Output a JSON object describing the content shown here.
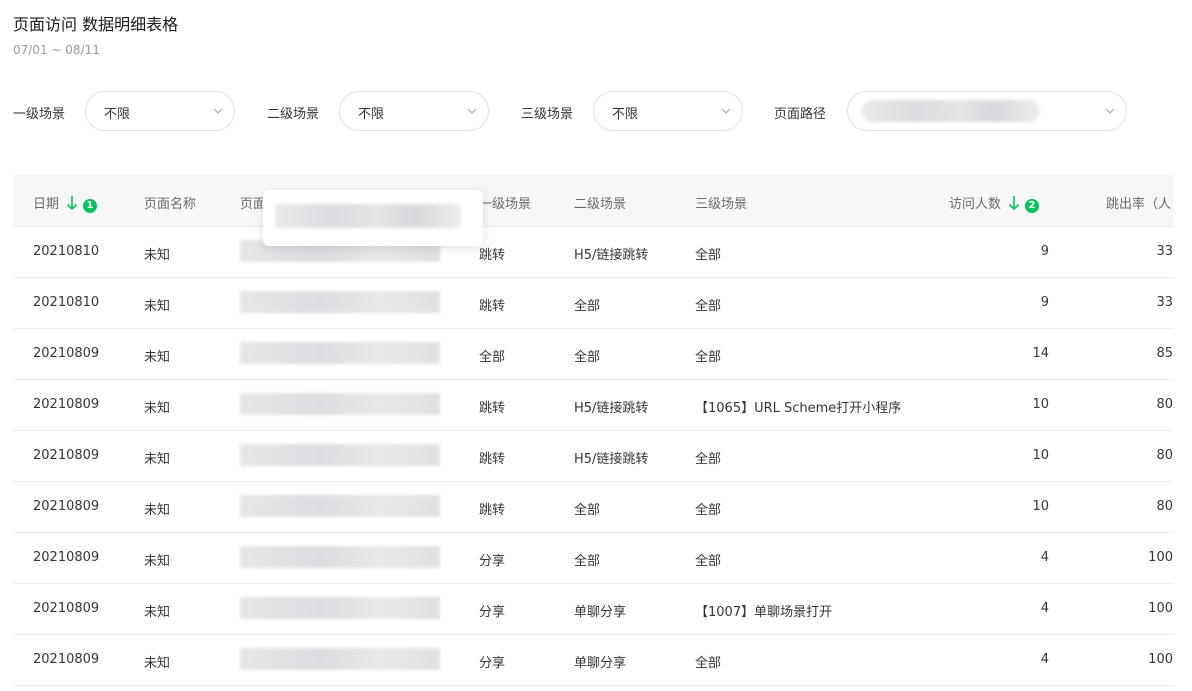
{
  "header": {
    "title": "页面访问 数据明细表格",
    "date_range": "07/01 ~ 08/11"
  },
  "filters": [
    {
      "label": "一级场景",
      "value": "不限"
    },
    {
      "label": "二级场景",
      "value": "不限"
    },
    {
      "label": "三级场景",
      "value": "不限"
    },
    {
      "label": "页面路径",
      "value": ""
    }
  ],
  "table": {
    "columns": [
      {
        "label": "日期",
        "sort": "desc",
        "badge": "1"
      },
      {
        "label": "页面名称"
      },
      {
        "label": "页面"
      },
      {
        "label": "一级场景"
      },
      {
        "label": "二级场景"
      },
      {
        "label": "三级场景"
      },
      {
        "label": "访问人数",
        "sort": "desc",
        "badge": "2"
      },
      {
        "label": "跳出率（人"
      }
    ],
    "rows": [
      {
        "date": "20210810",
        "name": "未知",
        "s1": "跳转",
        "s2": "H5/链接跳转",
        "s3": "全部",
        "visitors": "9",
        "bounce": "33"
      },
      {
        "date": "20210810",
        "name": "未知",
        "s1": "跳转",
        "s2": "全部",
        "s3": "全部",
        "visitors": "9",
        "bounce": "33"
      },
      {
        "date": "20210809",
        "name": "未知",
        "s1": "全部",
        "s2": "全部",
        "s3": "全部",
        "visitors": "14",
        "bounce": "85"
      },
      {
        "date": "20210809",
        "name": "未知",
        "s1": "跳转",
        "s2": "H5/链接跳转",
        "s3": "【1065】URL Scheme打开小程序",
        "visitors": "10",
        "bounce": "80"
      },
      {
        "date": "20210809",
        "name": "未知",
        "s1": "跳转",
        "s2": "H5/链接跳转",
        "s3": "全部",
        "visitors": "10",
        "bounce": "80"
      },
      {
        "date": "20210809",
        "name": "未知",
        "s1": "跳转",
        "s2": "全部",
        "s3": "全部",
        "visitors": "10",
        "bounce": "80"
      },
      {
        "date": "20210809",
        "name": "未知",
        "s1": "分享",
        "s2": "全部",
        "s3": "全部",
        "visitors": "4",
        "bounce": "100"
      },
      {
        "date": "20210809",
        "name": "未知",
        "s1": "分享",
        "s2": "单聊分享",
        "s3": "【1007】单聊场景打开",
        "visitors": "4",
        "bounce": "100"
      },
      {
        "date": "20210809",
        "name": "未知",
        "s1": "分享",
        "s2": "单聊分享",
        "s3": "全部",
        "visitors": "4",
        "bounce": "100"
      }
    ]
  },
  "colors": {
    "accent": "#07c160",
    "header_bg": "#f7f7f7",
    "border": "#ececec"
  },
  "icons": {
    "select_arrow": "chevron-down-icon",
    "sort": "arrow-down-icon"
  }
}
